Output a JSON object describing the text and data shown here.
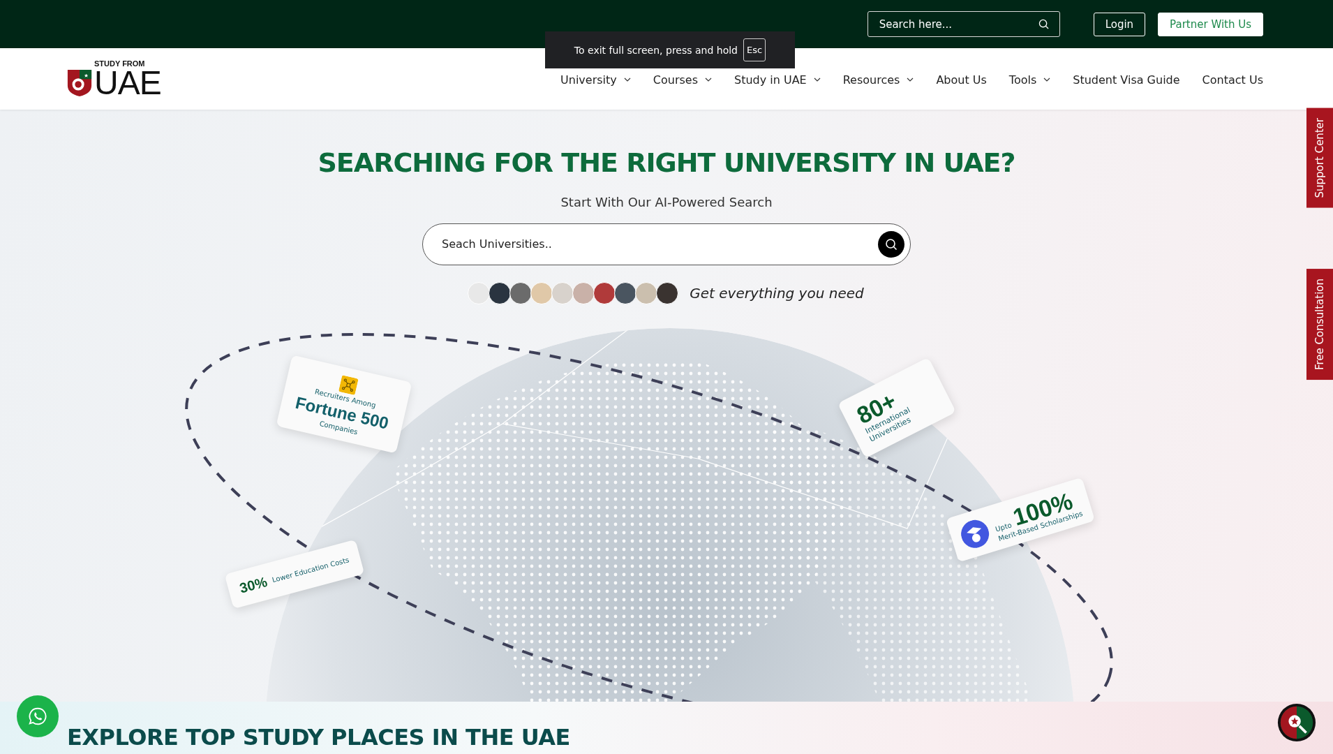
{
  "top_bar": {
    "search": {
      "placeholder": "Search here..."
    },
    "buttons": [
      {
        "label": "Login",
        "kind": "outline"
      },
      {
        "label": "Partner With Us",
        "kind": "filled"
      }
    ]
  },
  "fullscreen_toast": {
    "message": "To exit full screen, press and hold",
    "key": "Esc"
  },
  "logo": {
    "small_text": "STUDY FROM",
    "large_text": "UAE"
  },
  "nav": [
    {
      "label": "University",
      "dropdown": true
    },
    {
      "label": "Courses",
      "dropdown": true
    },
    {
      "label": "Study in UAE",
      "dropdown": true
    },
    {
      "label": "Resources",
      "dropdown": true
    },
    {
      "label": "About Us",
      "dropdown": false
    },
    {
      "label": "Tools",
      "dropdown": true
    },
    {
      "label": "Student Visa Guide",
      "dropdown": false
    },
    {
      "label": "Contact Us",
      "dropdown": false
    }
  ],
  "hero": {
    "title": "SEARCHING FOR THE RIGHT UNIVERSITY IN UAE?",
    "subtitle": "Start With Our AI-Powered Search",
    "search": {
      "placeholder": "Seach Universities.."
    },
    "tagline": "Get everything you need",
    "stat_cards": [
      {
        "kind": "icon-top",
        "label_above": "Recruiters Among",
        "value": "Fortune 500",
        "label_below": "Companies"
      },
      {
        "kind": "plain",
        "value": "80+",
        "label_below": "International Universities"
      },
      {
        "kind": "icon-left",
        "label_above": "Upto",
        "value": "100%",
        "label_below": "Merit-Based Scholarships"
      },
      {
        "kind": "inline",
        "value": "30%",
        "label_below": "Lower Education Costs"
      }
    ]
  },
  "side_tabs": [
    {
      "label": "Support Center"
    },
    {
      "label": "Free Consultation"
    }
  ],
  "next_section": {
    "title": "EXPLORE TOP STUDY PLACES IN THE UAE"
  }
}
